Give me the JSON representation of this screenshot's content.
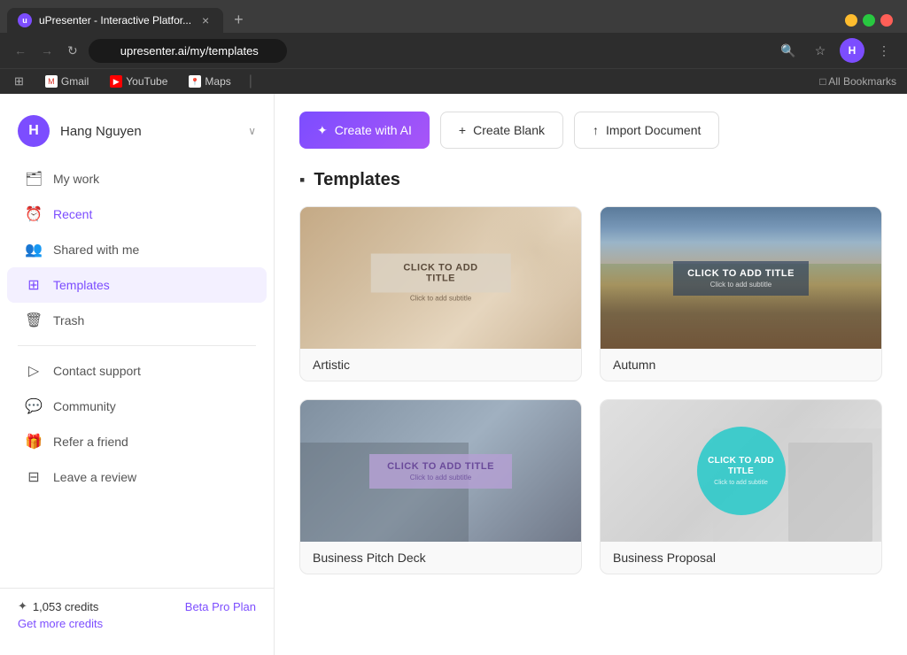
{
  "browser": {
    "tab": {
      "favicon_letter": "u",
      "title": "uPresenter - Interactive Platfor...",
      "close_label": "×"
    },
    "new_tab_label": "+",
    "window_controls": {
      "close": "×",
      "minimize": "−",
      "maximize": "□"
    },
    "nav": {
      "back_label": "←",
      "forward_label": "→",
      "refresh_label": "↻",
      "url": "upresenter.ai/my/templates",
      "lock_icon": "🔒"
    },
    "toolbar_icons": {
      "search": "🔍",
      "bookmark_star": "☆",
      "profile_letter": "H",
      "more": "⋮"
    },
    "bookmarks": {
      "apps_label": "⊞",
      "items": [
        {
          "id": "gmail",
          "label": "Gmail",
          "favicon": "M"
        },
        {
          "id": "youtube",
          "label": "YouTube",
          "favicon": "▶"
        },
        {
          "id": "maps",
          "label": "Maps",
          "favicon": "📍"
        }
      ],
      "separator": "|",
      "bookmarks_label": "□ All Bookmarks"
    }
  },
  "sidebar": {
    "user": {
      "avatar_letter": "H",
      "name": "Hang Nguyen",
      "chevron": "∨"
    },
    "nav_items": [
      {
        "id": "my-work",
        "icon": "🗂",
        "label": "My work",
        "active": false
      },
      {
        "id": "recent",
        "icon": "⏰",
        "label": "Recent",
        "active": false
      },
      {
        "id": "shared",
        "icon": "👥",
        "label": "Shared with me",
        "active": false
      },
      {
        "id": "templates",
        "icon": "⊞",
        "label": "Templates",
        "active": true
      },
      {
        "id": "trash",
        "icon": "🗑",
        "label": "Trash",
        "active": false
      },
      {
        "id": "contact-support",
        "icon": "▷",
        "label": "Contact support",
        "active": false
      },
      {
        "id": "community",
        "icon": "💬",
        "label": "Community",
        "active": false
      },
      {
        "id": "refer",
        "icon": "🎁",
        "label": "Refer a friend",
        "active": false
      },
      {
        "id": "review",
        "icon": "⊟",
        "label": "Leave a review",
        "active": false
      }
    ],
    "footer": {
      "credits_icon": "✦",
      "credits_value": "1,053 credits",
      "plan_label": "Beta Pro Plan",
      "get_credits_label": "Get more credits"
    }
  },
  "main": {
    "actions": {
      "create_ai_icon": "✦",
      "create_ai_label": "Create with AI",
      "create_blank_icon": "+",
      "create_blank_label": "Create Blank",
      "import_icon": "↑",
      "import_label": "Import Document"
    },
    "section": {
      "icon": "▪",
      "title": "Templates"
    },
    "templates": [
      {
        "id": "artistic",
        "label": "Artistic",
        "type": "artistic",
        "title_text": "CLICK TO ADD TITLE",
        "subtitle_text": "Click to add subtitle"
      },
      {
        "id": "autumn",
        "label": "Autumn",
        "type": "autumn",
        "title_text": "CLICK TO ADD TITLE",
        "subtitle_text": "Click to add subtitle"
      },
      {
        "id": "business-pitch",
        "label": "Business Pitch Deck",
        "type": "pitch",
        "title_text": "CLICK TO ADD TITLE",
        "subtitle_text": "Click to add subtitle"
      },
      {
        "id": "business-proposal",
        "label": "Business Proposal",
        "type": "proposal",
        "title_text": "CLICK TO ADD TITLE",
        "subtitle_text": "Click to add subtitle"
      }
    ]
  }
}
